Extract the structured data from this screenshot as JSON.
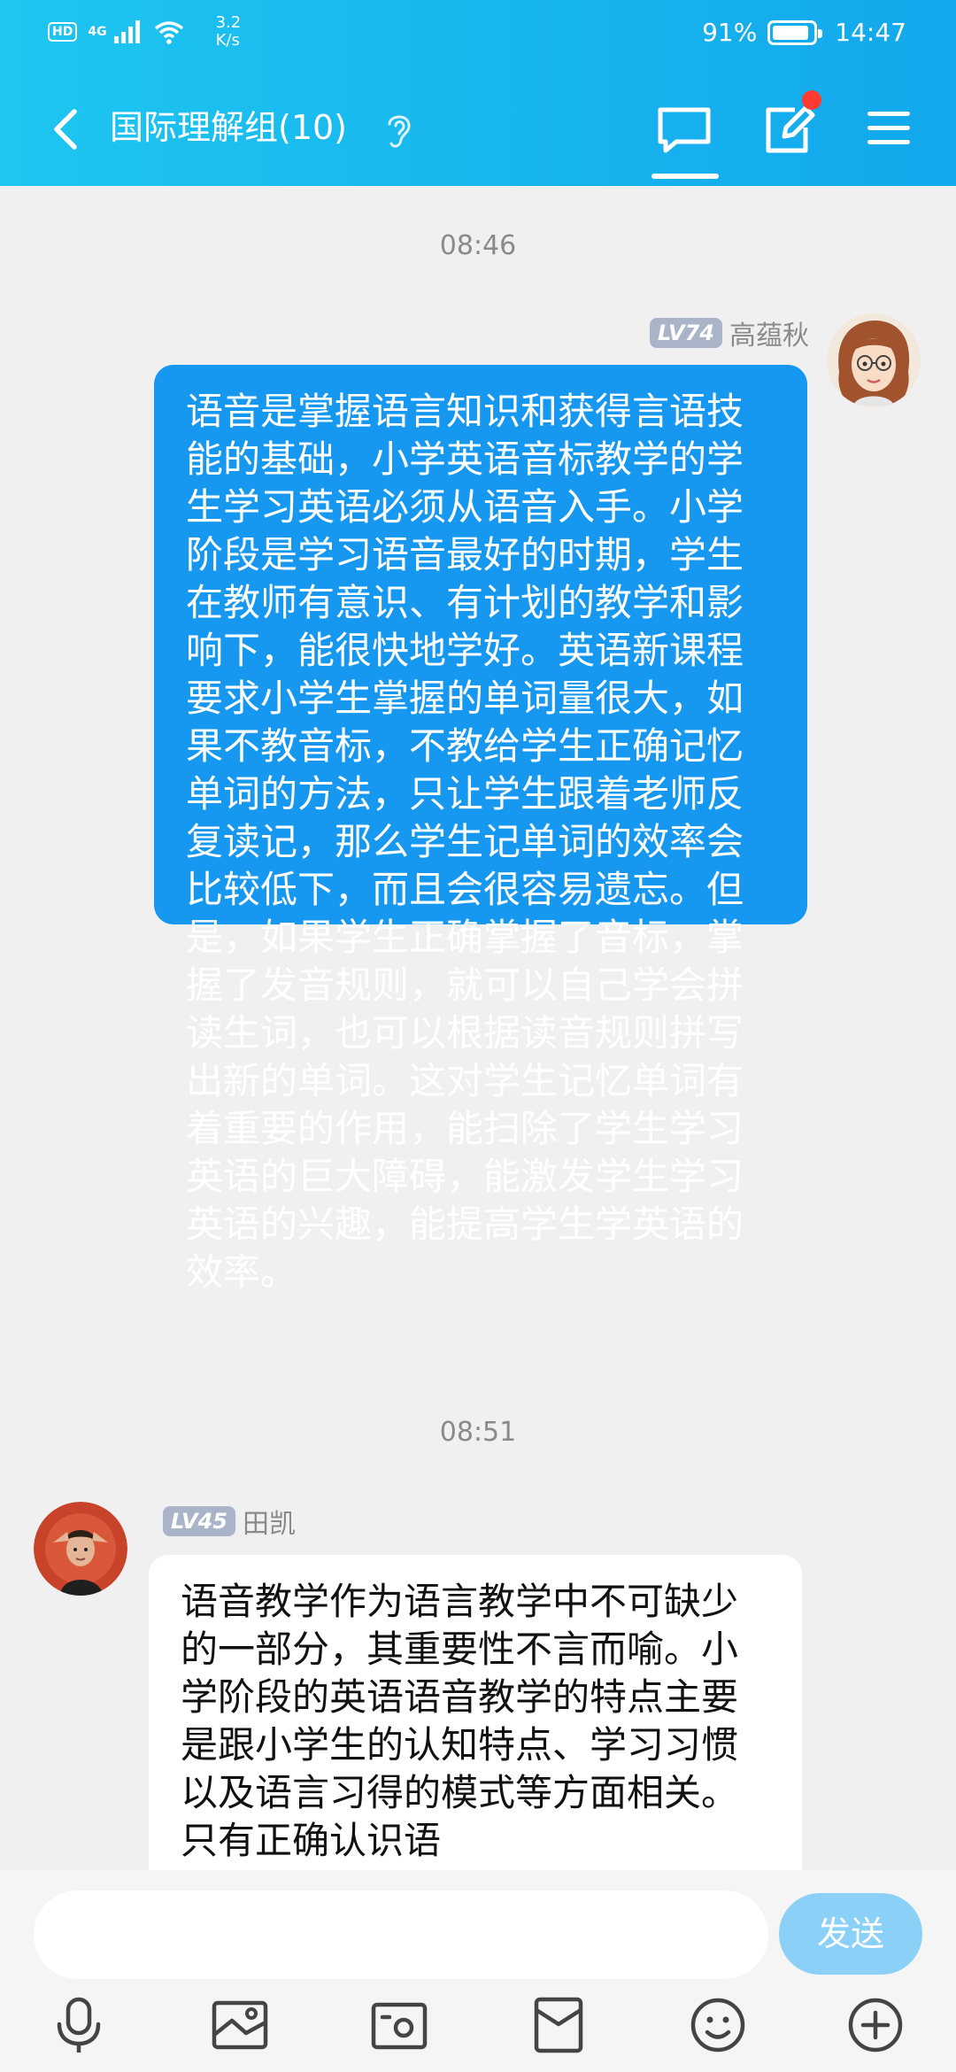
{
  "status_bar": {
    "hd": "HD",
    "network": "4G",
    "speed_value": "3.2",
    "speed_unit": "K/s",
    "battery": "91%",
    "battery_level": 0.91,
    "time": "14:47"
  },
  "header": {
    "title": "国际理解组(10)"
  },
  "messages": [
    {
      "time": "08:46",
      "sender": "高蕴秋",
      "level": "LV74",
      "side": "right",
      "text": "语音是掌握语言知识和获得言语技能的基础，小学英语音标教学的学生学习英语必须从语音入手。小学阶段是学习语音最好的时期，学生在教师有意识、有计划的教学和影响下，能很快地学好。英语新课程要求小学生掌握的单词量很大，如果不教音标，不教给学生正确记忆单词的方法，只让学生跟着老师反复读记，那么学生记单词的效率会比较低下，而且会很容易遗忘。但是，如果学生正确掌握了音标，掌握了发音规则，就可以自己学会拼读生词，也可以根据读音规则拼写出新的单词。这对学生记忆单词有着重要的作用，能扫除了学生学习英语的巨大障碍，能激发学生学习英语的兴趣，能提高学生学英语的效率。"
    },
    {
      "time": "08:51",
      "sender": "田凯",
      "level": "LV45",
      "side": "left",
      "text": "语音教学作为语言教学中不可缺少的一部分，其重要性不言而喻。小学阶段的英语语音教学的特点主要是跟小学生的认知特点、学习习惯以及语言习得的模式等方面相关。只有正确认识语"
    }
  ],
  "input": {
    "value": "",
    "send_label": "发送"
  },
  "toolbar_icons": [
    "microphone-icon",
    "image-icon",
    "camera-icon",
    "red-packet-icon",
    "emoji-icon",
    "plus-icon"
  ]
}
